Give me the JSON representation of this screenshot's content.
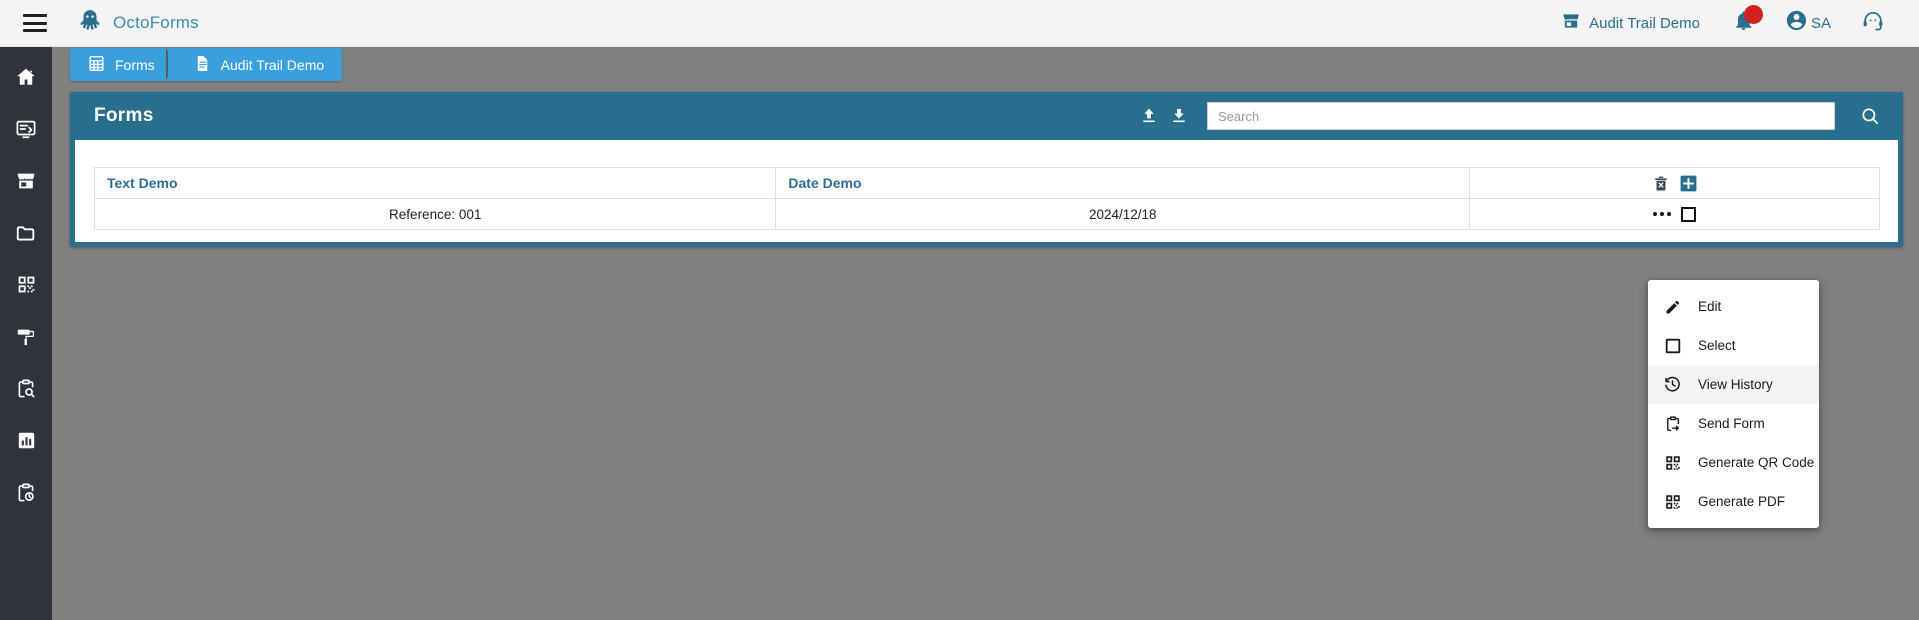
{
  "app": {
    "brand": "OctoForms",
    "menu_icon": "hamburger-icon",
    "logo_icon": "octopus-logo-icon"
  },
  "topbar": {
    "workspace": {
      "label": "Audit Trail Demo",
      "icon": "store-icon"
    },
    "notifications": {
      "icon": "bell-icon",
      "badge_color": "#d32020",
      "has_badge": true
    },
    "account": {
      "icon": "account-circle-icon",
      "initials": "SA"
    },
    "support": {
      "icon": "support-agent-icon"
    }
  },
  "sidebar": {
    "items": [
      {
        "name": "home",
        "icon": "home-icon"
      },
      {
        "name": "forms",
        "icon": "form-monitor-icon"
      },
      {
        "name": "store",
        "icon": "store-icon"
      },
      {
        "name": "folder",
        "icon": "folder-icon"
      },
      {
        "name": "qr-code",
        "icon": "qr-code-icon"
      },
      {
        "name": "design",
        "icon": "paint-roller-icon"
      },
      {
        "name": "inspect",
        "icon": "clipboard-search-icon"
      },
      {
        "name": "reports",
        "icon": "bar-chart-icon"
      },
      {
        "name": "history",
        "icon": "clipboard-clock-icon"
      }
    ]
  },
  "breadcrumb": {
    "items": [
      {
        "label": "Forms",
        "icon": "table-grid-icon"
      },
      {
        "label": "Audit Trail Demo",
        "icon": "document-icon"
      }
    ]
  },
  "panel": {
    "title": "Forms",
    "accent_color": "#2a6e8e",
    "upload_icon": "upload-icon",
    "download_icon": "download-icon",
    "search": {
      "placeholder": "Search",
      "value": "",
      "icon": "search-icon"
    }
  },
  "table": {
    "columns": [
      {
        "key": "text_demo",
        "label": "Text Demo"
      },
      {
        "key": "date_demo",
        "label": "Date Demo"
      },
      {
        "key": "actions",
        "label": ""
      }
    ],
    "header_actions": [
      {
        "name": "delete-selected",
        "icon": "trash-x-icon"
      },
      {
        "name": "add-record",
        "icon": "plus-icon"
      }
    ],
    "rows": [
      {
        "text_demo": "Reference: 001",
        "date_demo": "2024/12/18",
        "actions": {
          "kebab_icon": "more-options-icon",
          "checkbox_checked": false
        }
      }
    ]
  },
  "context_menu": {
    "visible": true,
    "items": [
      {
        "label": "Edit",
        "icon": "pencil-icon",
        "active": false
      },
      {
        "label": "Select",
        "icon": "checkbox-icon",
        "active": false
      },
      {
        "label": "View History",
        "icon": "history-clock-icon",
        "active": true
      },
      {
        "label": "Send Form",
        "icon": "send-clipboard-icon",
        "active": false
      },
      {
        "label": "Generate QR Code",
        "icon": "qr-code-icon",
        "active": false
      },
      {
        "label": "Generate PDF",
        "icon": "qr-code-icon",
        "active": false
      }
    ]
  }
}
